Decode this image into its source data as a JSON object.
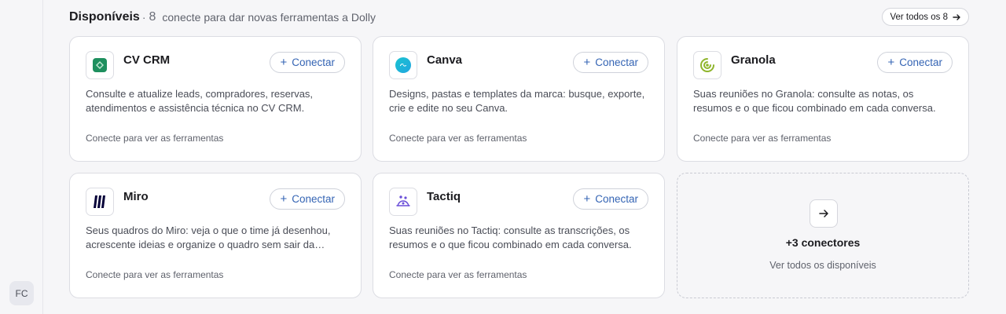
{
  "sidebar": {
    "avatar_initials": "FC"
  },
  "section": {
    "title": "Disponíveis",
    "separator": "·",
    "count": "8",
    "subtitle": "conecte para dar novas ferramentas a Dolly",
    "view_all_label": "Ver todos os 8"
  },
  "connect_label": "Conectar",
  "connectors": [
    {
      "name": "CV CRM",
      "icon": "cvcrm-logo-icon",
      "brand_color": "#1e8f5e",
      "description": "Consulte e atualize leads, compradores, reservas, atendimentos e assistência técnica no CV CRM.",
      "hint": "Conecte para ver as ferramentas"
    },
    {
      "name": "Canva",
      "icon": "canva-logo-icon",
      "brand_color": "#1fc4cf",
      "description": "Designs, pastas e templates da marca: busque, exporte, crie e edite no seu Canva.",
      "hint": "Conecte para ver as ferramentas"
    },
    {
      "name": "Granola",
      "icon": "granola-logo-icon",
      "brand_color": "#8fb52c",
      "description": "Suas reuniões no Granola: consulte as notas, os resumos e o que ficou combinado em cada conversa.",
      "hint": "Conecte para ver as ferramentas"
    },
    {
      "name": "Miro",
      "icon": "miro-logo-icon",
      "brand_color": "#050038",
      "description": "Seus quadros do Miro: veja o que o time já desenhou, acrescente ideias e organize o quadro sem sair da…",
      "hint": "Conecte para ver as ferramentas"
    },
    {
      "name": "Tactiq",
      "icon": "tactiq-logo-icon",
      "brand_color": "#6a4fd8",
      "description": "Suas reuniões no Tactiq: consulte as transcrições, os resumos e o que ficou combinado em cada conversa.",
      "hint": "Conecte para ver as ferramentas"
    }
  ],
  "more": {
    "icon": "arrow-right-icon",
    "title": "+3 conectores",
    "subtitle": "Ver todos os disponíveis"
  }
}
